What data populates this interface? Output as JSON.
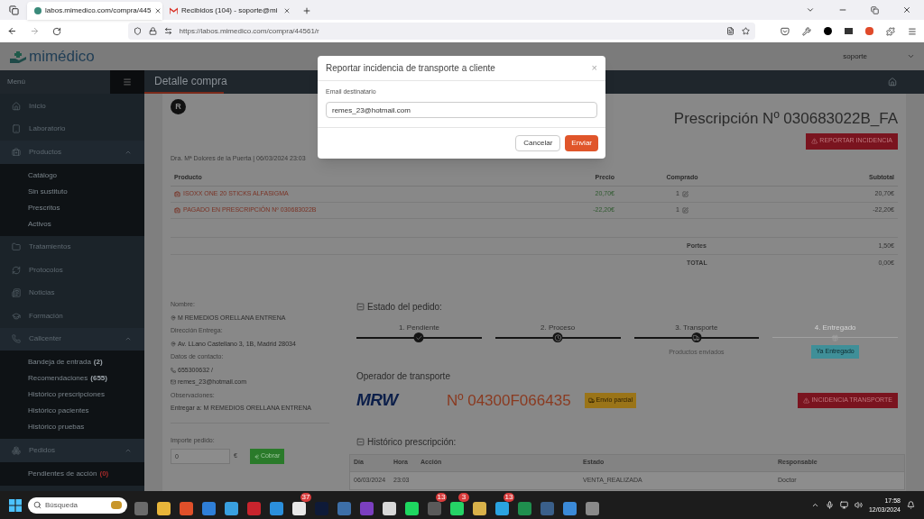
{
  "browser": {
    "tabs": [
      {
        "title": "labos.mimedico.com/compra/445",
        "selected": true
      },
      {
        "title": "Recibidos (104) - soporte@mi",
        "selected": false
      }
    ],
    "address": "https://labos.mimedico.com/compra/44561/r"
  },
  "header": {
    "logo": "mimédico",
    "user": "soporte"
  },
  "navbar": {
    "menu_label": "Menú",
    "page_title": "Detalle compra"
  },
  "sidebar": {
    "items": [
      {
        "label": "Inicio"
      },
      {
        "label": "Laboratorio"
      },
      {
        "label": "Productos",
        "expanded": true,
        "children": [
          {
            "label": "Catálogo"
          },
          {
            "label": "Sin sustituto"
          },
          {
            "label": "Prescritos"
          },
          {
            "label": "Activos"
          }
        ]
      },
      {
        "label": "Tratamientos"
      },
      {
        "label": "Protocolos"
      },
      {
        "label": "Noticias"
      },
      {
        "label": "Formación"
      },
      {
        "label": "Callcenter",
        "expanded": true,
        "children": [
          {
            "label": "Bandeja de entrada",
            "count": "(2)",
            "alert": false
          },
          {
            "label": "Recomendaciones",
            "count": "(655)",
            "alert": false
          },
          {
            "label": "Histórico prescripciones"
          },
          {
            "label": "Histórico pacientes"
          },
          {
            "label": "Histórico pruebas"
          }
        ]
      },
      {
        "label": "Pedidos",
        "expanded": true,
        "children": [
          {
            "label": "Pendientes de acción",
            "count": "(0)",
            "alert": true
          }
        ]
      }
    ]
  },
  "prescription": {
    "avatar": "R",
    "title": "Prescripción Nº 030683022B_FA",
    "report_button": "REPORTAR INCIDENCIA",
    "doctor_line": "Dra. Mª Dolores de la Puerta | 06/03/2024 23:03"
  },
  "products_table": {
    "columns": [
      "Producto",
      "Precio",
      "Comprado",
      "Subtotal"
    ],
    "rows": [
      {
        "product": "ISOXX ONE 20 STICKS ALFASIGMA",
        "price": "20,70€",
        "quantity": "1",
        "subtotal": "20,70€"
      },
      {
        "product": "PAGADO EN PRESCRIPCIÓN Nº 030683022B",
        "price": "-22,20€",
        "quantity": "1",
        "subtotal": "-22,20€"
      }
    ],
    "totals": [
      {
        "label": "Portes",
        "value": "1,50€"
      },
      {
        "label": "TOTAL",
        "value": "0,00€"
      }
    ]
  },
  "customer": [
    {
      "label": "Nombre:",
      "lines": [
        {
          "kind": "location",
          "text": "M REMEDIOS ORELLANA ENTRENA"
        }
      ]
    },
    {
      "label": "Dirección Entrega:",
      "lines": [
        {
          "kind": "location",
          "text": "Av. LLano Castellano 3, 1B, Madrid 28034"
        }
      ]
    },
    {
      "label": "Datos de contacto:",
      "lines": [
        {
          "kind": "phone",
          "text": "655300632 /"
        },
        {
          "kind": "email",
          "text": "remes_23@hotmail.com"
        }
      ]
    },
    {
      "label": "Observaciones:",
      "lines": [
        {
          "kind": "plain",
          "text": "Entregar a: M REMEDIOS ORELLANA ENTRENA"
        }
      ]
    }
  ],
  "payment": {
    "label": "Importe pedido:",
    "value": "0",
    "currency": "€",
    "button": "Cobrar"
  },
  "order_status": {
    "title": "Estado del pedido:",
    "steps": [
      {
        "label": "1. Pendiente",
        "completed": true
      },
      {
        "label": "2. Proceso",
        "completed": true
      },
      {
        "label": "3. Transporte",
        "completed": true,
        "note": "Productos enviados"
      },
      {
        "label": "4. Entregado",
        "completed": false,
        "button": "Ya Entregado"
      }
    ]
  },
  "transport": {
    "title": "Operador de transporte",
    "carrier": "MRW",
    "tracking": "Nº 04300F066435",
    "partial_button": "Envío parcial",
    "incident_button": "INCIDENCIA TRANSPORTE"
  },
  "history": {
    "title": "Histórico prescripción:",
    "columns": [
      "Día",
      "Hora",
      "Acción",
      "Estado",
      "Responsable"
    ],
    "rows": [
      {
        "day": "06/03/2024",
        "time": "23:03",
        "state": "VENTA_REALIZADA",
        "responsible": "Doctor"
      }
    ]
  },
  "modal": {
    "title": "Reportar incidencia de transporte a cliente",
    "close": "×",
    "field_label": "Email destinatario",
    "field_value": "remes_23@hotmail.com",
    "cancel": "Cancelar",
    "submit": "Enviar"
  },
  "taskbar": {
    "search_placeholder": "Búsqueda",
    "apps": [
      {
        "color": "#6b6b6b"
      },
      {
        "color": "#e8b53a"
      },
      {
        "color": "#e0502a"
      },
      {
        "color": "#2f7fd8"
      },
      {
        "color": "#39a0e0"
      },
      {
        "color": "#c8242d"
      },
      {
        "color": "#2b8fdc"
      },
      {
        "color": "#e8e8e8",
        "badge": "37"
      },
      {
        "color": "#0e1a38"
      },
      {
        "color": "#3d6fa8"
      },
      {
        "color": "#7b3fc0"
      },
      {
        "color": "#d8d8d8"
      },
      {
        "color": "#1ed760"
      },
      {
        "color": "#5a5a5a",
        "badge": "13"
      },
      {
        "color": "#25d366",
        "badge": "3"
      },
      {
        "color": "#d9b24a"
      },
      {
        "color": "#2aa3e0",
        "badge": "13"
      },
      {
        "color": "#1f8f4e"
      },
      {
        "color": "#3a5f8a"
      },
      {
        "color": "#3b8ad8"
      },
      {
        "color": "#8a8a8a"
      }
    ],
    "time": "17:58",
    "date": "12/03/2024"
  }
}
